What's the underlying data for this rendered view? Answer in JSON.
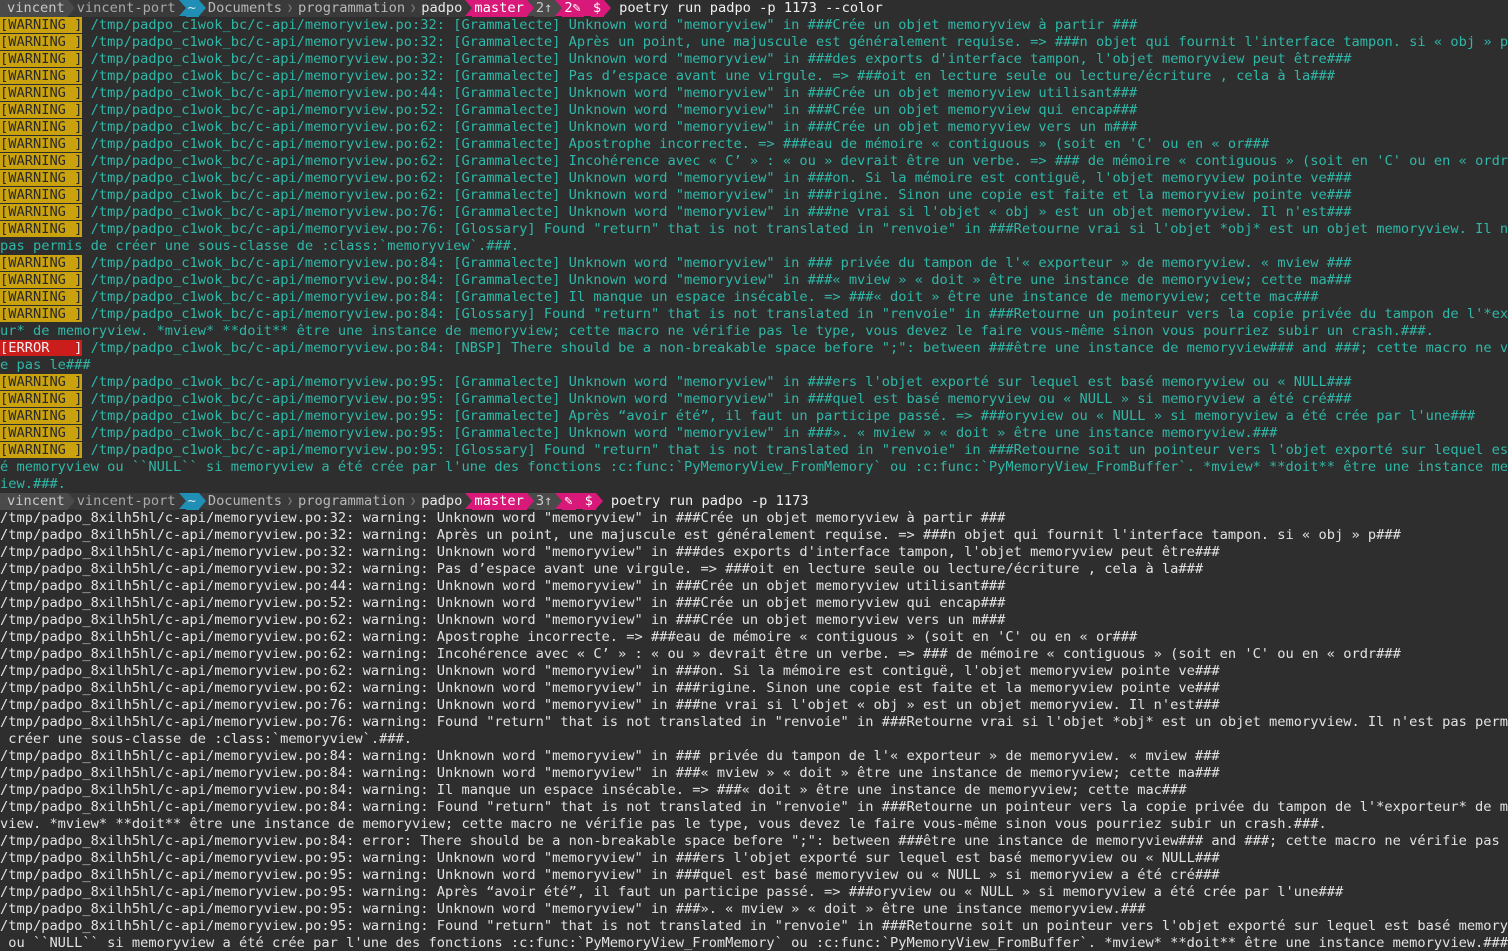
{
  "prompt1": {
    "user": "vincent",
    "host": "vincent-port",
    "home_icon": "~",
    "path": [
      "Documents",
      "programmation",
      "padpo"
    ],
    "branch": "master",
    "ahead": "2↑",
    "stash": "2✎",
    "dollar": "$",
    "command": "poetry run padpo -p 1173 --color"
  },
  "colored_output": [
    {
      "tag": "[WARNING ]",
      "level": "warning",
      "path": "/tmp/padpo_c1wok_bc/c-api/memoryview.po:32:",
      "msg": "[Grammalecte] Unknown word \"memoryview\" in ###Crée un objet memoryview à partir ###"
    },
    {
      "tag": "[WARNING ]",
      "level": "warning",
      "path": "/tmp/padpo_c1wok_bc/c-api/memoryview.po:32:",
      "msg": "[Grammalecte] Après un point, une majuscule est généralement requise. => ###n objet qui fournit l'interface tampon. si « obj » p###"
    },
    {
      "tag": "[WARNING ]",
      "level": "warning",
      "path": "/tmp/padpo_c1wok_bc/c-api/memoryview.po:32:",
      "msg": "[Grammalecte] Unknown word \"memoryview\" in ###des exports d'interface tampon, l'objet memoryview peut être###"
    },
    {
      "tag": "[WARNING ]",
      "level": "warning",
      "path": "/tmp/padpo_c1wok_bc/c-api/memoryview.po:32:",
      "msg": "[Grammalecte] Pas d’espace avant une virgule. => ###oit en lecture seule ou lecture/écriture , cela à la###"
    },
    {
      "tag": "[WARNING ]",
      "level": "warning",
      "path": "/tmp/padpo_c1wok_bc/c-api/memoryview.po:44:",
      "msg": "[Grammalecte] Unknown word \"memoryview\" in ###Crée un objet memoryview utilisant###"
    },
    {
      "tag": "[WARNING ]",
      "level": "warning",
      "path": "/tmp/padpo_c1wok_bc/c-api/memoryview.po:52:",
      "msg": "[Grammalecte] Unknown word \"memoryview\" in ###Crée un objet memoryview qui encap###"
    },
    {
      "tag": "[WARNING ]",
      "level": "warning",
      "path": "/tmp/padpo_c1wok_bc/c-api/memoryview.po:62:",
      "msg": "[Grammalecte] Unknown word \"memoryview\" in ###Crée un objet memoryview vers un m###"
    },
    {
      "tag": "[WARNING ]",
      "level": "warning",
      "path": "/tmp/padpo_c1wok_bc/c-api/memoryview.po:62:",
      "msg": "[Grammalecte] Apostrophe incorrecte. => ###eau de mémoire « contiguous » (soit en 'C' ou en « or###"
    },
    {
      "tag": "[WARNING ]",
      "level": "warning",
      "path": "/tmp/padpo_c1wok_bc/c-api/memoryview.po:62:",
      "msg": "[Grammalecte] Incohérence avec « C’ » : « ou » devrait être un verbe. => ### de mémoire « contiguous » (soit en 'C' ou en « ordr###"
    },
    {
      "tag": "[WARNING ]",
      "level": "warning",
      "path": "/tmp/padpo_c1wok_bc/c-api/memoryview.po:62:",
      "msg": "[Grammalecte] Unknown word \"memoryview\" in ###on. Si la mémoire est contiguë, l'objet memoryview pointe ve###"
    },
    {
      "tag": "[WARNING ]",
      "level": "warning",
      "path": "/tmp/padpo_c1wok_bc/c-api/memoryview.po:62:",
      "msg": "[Grammalecte] Unknown word \"memoryview\" in ###rigine. Sinon une copie est faite et la memoryview pointe ve###"
    },
    {
      "tag": "[WARNING ]",
      "level": "warning",
      "path": "/tmp/padpo_c1wok_bc/c-api/memoryview.po:76:",
      "msg": "[Grammalecte] Unknown word \"memoryview\" in ###ne vrai si l'objet « obj » est un objet memoryview. Il n'est###"
    },
    {
      "tag": "[WARNING ]",
      "level": "warning",
      "path": "/tmp/padpo_c1wok_bc/c-api/memoryview.po:76:",
      "msg": "[Glossary] Found \"return\" that is not translated in \"renvoie\" in ###Retourne vrai si l'objet *obj* est un objet memoryview. Il n'est",
      "cont": "pas permis de créer une sous-classe de :class:`memoryview`.###."
    },
    {
      "tag": "[WARNING ]",
      "level": "warning",
      "path": "/tmp/padpo_c1wok_bc/c-api/memoryview.po:84:",
      "msg": "[Grammalecte] Unknown word \"memoryview\" in ### privée du tampon de l'« exporteur » de memoryview. « mview ###"
    },
    {
      "tag": "[WARNING ]",
      "level": "warning",
      "path": "/tmp/padpo_c1wok_bc/c-api/memoryview.po:84:",
      "msg": "[Grammalecte] Unknown word \"memoryview\" in ###« mview » « doit » être une instance de memoryview; cette ma###"
    },
    {
      "tag": "[WARNING ]",
      "level": "warning",
      "path": "/tmp/padpo_c1wok_bc/c-api/memoryview.po:84:",
      "msg": "[Grammalecte] Il manque un espace insécable. => ###« doit » être une instance de memoryview; cette mac###"
    },
    {
      "tag": "[WARNING ]",
      "level": "warning",
      "path": "/tmp/padpo_c1wok_bc/c-api/memoryview.po:84:",
      "msg": "[Glossary] Found \"return\" that is not translated in \"renvoie\" in ###Retourne un pointeur vers la copie privée du tampon de l'*exporte",
      "cont": "ur* de memoryview. *mview* **doit** être une instance de memoryview; cette macro ne vérifie pas le type, vous devez le faire vous-même sinon vous pourriez subir un crash.###."
    },
    {
      "tag": "[ERROR   ]",
      "level": "error",
      "path": "/tmp/padpo_c1wok_bc/c-api/memoryview.po:84:",
      "msg": "[NBSP] There should be a non-breakable space before \";\": between ###être une instance de memoryview### and ###; cette macro ne vérifi",
      "cont": "e pas le###"
    },
    {
      "tag": "[WARNING ]",
      "level": "warning",
      "path": "/tmp/padpo_c1wok_bc/c-api/memoryview.po:95:",
      "msg": "[Grammalecte] Unknown word \"memoryview\" in ###ers l'objet exporté sur lequel est basé memoryview ou « NULL###"
    },
    {
      "tag": "[WARNING ]",
      "level": "warning",
      "path": "/tmp/padpo_c1wok_bc/c-api/memoryview.po:95:",
      "msg": "[Grammalecte] Unknown word \"memoryview\" in ###quel est basé memoryview ou « NULL » si memoryview a été cré###"
    },
    {
      "tag": "[WARNING ]",
      "level": "warning",
      "path": "/tmp/padpo_c1wok_bc/c-api/memoryview.po:95:",
      "msg": "[Grammalecte] Après “avoir été”, il faut un participe passé. => ###oryview ou « NULL » si memoryview a été crée par l'une###"
    },
    {
      "tag": "[WARNING ]",
      "level": "warning",
      "path": "/tmp/padpo_c1wok_bc/c-api/memoryview.po:95:",
      "msg": "[Grammalecte] Unknown word \"memoryview\" in ###». « mview » « doit » être une instance memoryview.###"
    },
    {
      "tag": "[WARNING ]",
      "level": "warning",
      "path": "/tmp/padpo_c1wok_bc/c-api/memoryview.po:95:",
      "msg": "[Glossary] Found \"return\" that is not translated in \"renvoie\" in ###Retourne soit un pointeur vers l'objet exporté sur lequel est bas",
      "cont": "é memoryview ou ``NULL`` si memoryview a été crée par l'une des fonctions :c:func:`PyMemoryView_FromMemory` ou :c:func:`PyMemoryView_FromBuffer`. *mview* **doit** être une instance memoryv",
      "cont2": "iew.###."
    }
  ],
  "prompt2": {
    "user": "vincent",
    "host": "vincent-port",
    "home_icon": "~",
    "path": [
      "Documents",
      "programmation",
      "padpo"
    ],
    "branch": "master",
    "ahead": "3↑",
    "stash": "✎",
    "dollar": "$",
    "command": "poetry run padpo -p 1173"
  },
  "plain_output": [
    "/tmp/padpo_8xilh5hl/c-api/memoryview.po:32: warning: Unknown word \"memoryview\" in ###Crée un objet memoryview à partir ###",
    "/tmp/padpo_8xilh5hl/c-api/memoryview.po:32: warning: Après un point, une majuscule est généralement requise. => ###n objet qui fournit l'interface tampon. si « obj » p###",
    "/tmp/padpo_8xilh5hl/c-api/memoryview.po:32: warning: Unknown word \"memoryview\" in ###des exports d'interface tampon, l'objet memoryview peut être###",
    "/tmp/padpo_8xilh5hl/c-api/memoryview.po:32: warning: Pas d’espace avant une virgule. => ###oit en lecture seule ou lecture/écriture , cela à la###",
    "/tmp/padpo_8xilh5hl/c-api/memoryview.po:44: warning: Unknown word \"memoryview\" in ###Crée un objet memoryview utilisant###",
    "/tmp/padpo_8xilh5hl/c-api/memoryview.po:52: warning: Unknown word \"memoryview\" in ###Crée un objet memoryview qui encap###",
    "/tmp/padpo_8xilh5hl/c-api/memoryview.po:62: warning: Unknown word \"memoryview\" in ###Crée un objet memoryview vers un m###",
    "/tmp/padpo_8xilh5hl/c-api/memoryview.po:62: warning: Apostrophe incorrecte. => ###eau de mémoire « contiguous » (soit en 'C' ou en « or###",
    "/tmp/padpo_8xilh5hl/c-api/memoryview.po:62: warning: Incohérence avec « C’ » : « ou » devrait être un verbe. => ### de mémoire « contiguous » (soit en 'C' ou en « ordr###",
    "/tmp/padpo_8xilh5hl/c-api/memoryview.po:62: warning: Unknown word \"memoryview\" in ###on. Si la mémoire est contiguë, l'objet memoryview pointe ve###",
    "/tmp/padpo_8xilh5hl/c-api/memoryview.po:62: warning: Unknown word \"memoryview\" in ###rigine. Sinon une copie est faite et la memoryview pointe ve###",
    "/tmp/padpo_8xilh5hl/c-api/memoryview.po:76: warning: Unknown word \"memoryview\" in ###ne vrai si l'objet « obj » est un objet memoryview. Il n'est###",
    "/tmp/padpo_8xilh5hl/c-api/memoryview.po:76: warning: Found \"return\" that is not translated in \"renvoie\" in ###Retourne vrai si l'objet *obj* est un objet memoryview. Il n'est pas permis de",
    " créer une sous-classe de :class:`memoryview`.###.",
    "/tmp/padpo_8xilh5hl/c-api/memoryview.po:84: warning: Unknown word \"memoryview\" in ### privée du tampon de l'« exporteur » de memoryview. « mview ###",
    "/tmp/padpo_8xilh5hl/c-api/memoryview.po:84: warning: Unknown word \"memoryview\" in ###« mview » « doit » être une instance de memoryview; cette ma###",
    "/tmp/padpo_8xilh5hl/c-api/memoryview.po:84: warning: Il manque un espace insécable. => ###« doit » être une instance de memoryview; cette mac###",
    "/tmp/padpo_8xilh5hl/c-api/memoryview.po:84: warning: Found \"return\" that is not translated in \"renvoie\" in ###Retourne un pointeur vers la copie privée du tampon de l'*exporteur* de memory",
    "view. *mview* **doit** être une instance de memoryview; cette macro ne vérifie pas le type, vous devez le faire vous-même sinon vous pourriez subir un crash.###.",
    "/tmp/padpo_8xilh5hl/c-api/memoryview.po:84: error: There should be a non-breakable space before \";\": between ###être une instance de memoryview### and ###; cette macro ne vérifie pas le###",
    "/tmp/padpo_8xilh5hl/c-api/memoryview.po:95: warning: Unknown word \"memoryview\" in ###ers l'objet exporté sur lequel est basé memoryview ou « NULL###",
    "/tmp/padpo_8xilh5hl/c-api/memoryview.po:95: warning: Unknown word \"memoryview\" in ###quel est basé memoryview ou « NULL » si memoryview a été cré###",
    "/tmp/padpo_8xilh5hl/c-api/memoryview.po:95: warning: Après “avoir été”, il faut un participe passé. => ###oryview ou « NULL » si memoryview a été crée par l'une###",
    "/tmp/padpo_8xilh5hl/c-api/memoryview.po:95: warning: Unknown word \"memoryview\" in ###». « mview » « doit » être une instance memoryview.###",
    "/tmp/padpo_8xilh5hl/c-api/memoryview.po:95: warning: Found \"return\" that is not translated in \"renvoie\" in ###Retourne soit un pointeur vers l'objet exporté sur lequel est basé memoryview",
    " ou ``NULL`` si memoryview a été crée par l'une des fonctions :c:func:`PyMemoryView_FromMemory` ou :c:func:`PyMemoryView_FromBuffer`. *mview* **doit** être une instance memoryview.###."
  ],
  "colors": {
    "background": "#2e2e2e",
    "warning_tag": "#c9a20e",
    "error_tag": "#cc1d1d",
    "teal_text": "#2fb7a7",
    "branch_magenta": "#d8197a",
    "home_blue": "#1f8fb5"
  }
}
